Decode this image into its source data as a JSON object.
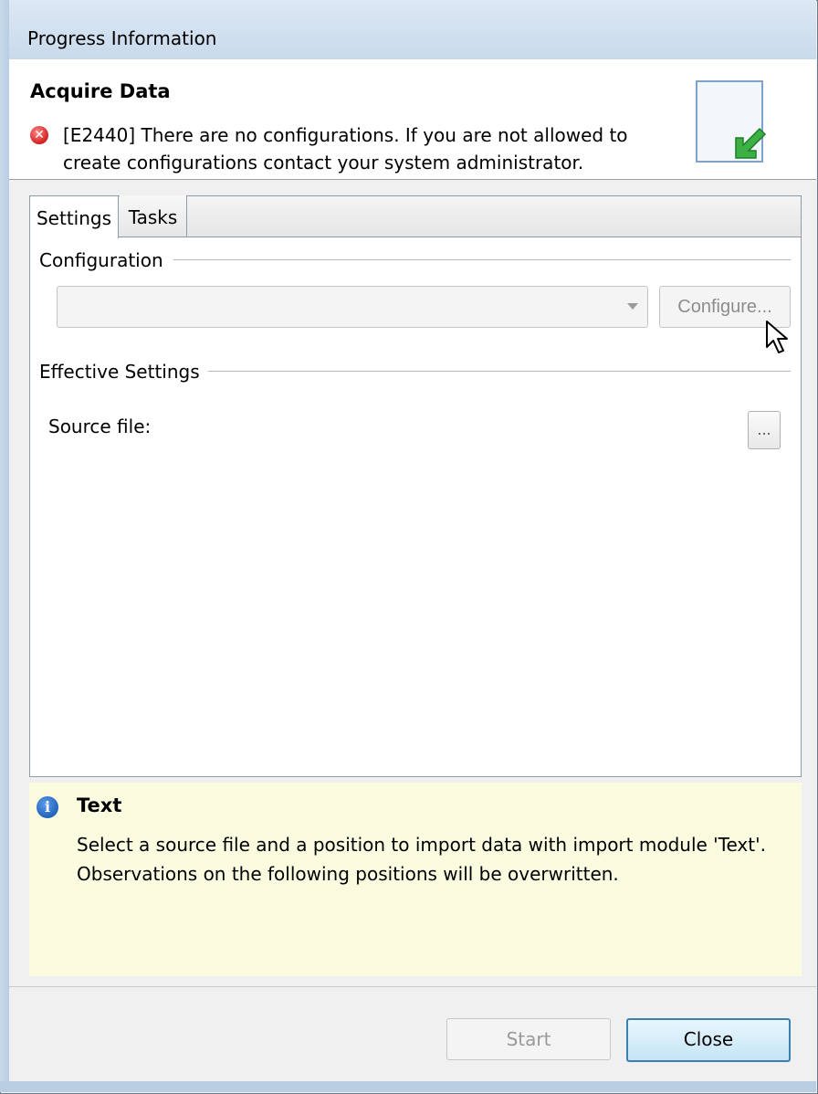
{
  "window": {
    "title": "Progress Information"
  },
  "header": {
    "title": "Acquire Data",
    "error_message": "[E2440] There are no configurations. If you are not allowed to create configurations contact your system administrator."
  },
  "tabs": [
    {
      "label": "Settings",
      "selected": true
    },
    {
      "label": "Tasks",
      "selected": false
    }
  ],
  "configuration": {
    "group_label": "Configuration",
    "select_value": "",
    "configure_button": "Configure..."
  },
  "effective_settings": {
    "group_label": "Effective Settings",
    "source_file_label": "Source file:",
    "browse_button": "..."
  },
  "info": {
    "title": "Text",
    "message": "Select a source file and a position to import data with import module 'Text'. Observations on the following positions will be overwritten."
  },
  "buttons": {
    "start": "Start",
    "close": "Close"
  },
  "icons": {
    "error": "error-icon",
    "info": "info-icon",
    "wizard": "import-arrow-icon",
    "cursor": "mouse-cursor-icon"
  }
}
